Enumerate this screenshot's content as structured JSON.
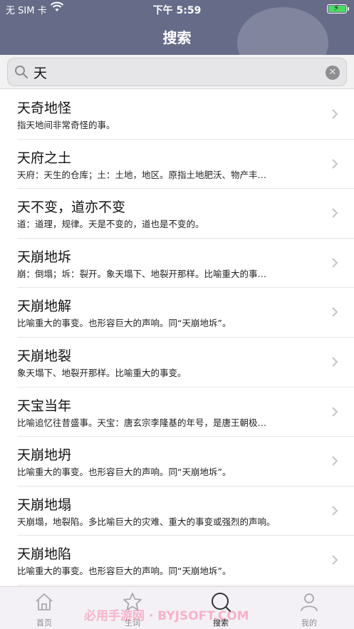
{
  "status": {
    "carrier": "无 SIM 卡",
    "time": "下午 5:59"
  },
  "header": {
    "title": "搜索"
  },
  "search": {
    "value": "天"
  },
  "results": [
    {
      "word": "天奇地怪",
      "desc": "指天地间非常奇怪的事。"
    },
    {
      "word": "天府之土",
      "desc": "天府：天生的仓库；土：土地，地区。原指土地肥沃、物产丰…"
    },
    {
      "word": "天不变，道亦不变",
      "desc": "道：道理，规律。天是不变的，道也是不变的。"
    },
    {
      "word": "天崩地坼",
      "desc": "崩：倒塌；坼：裂开。象天塌下、地裂开那样。比喻重大的事…"
    },
    {
      "word": "天崩地解",
      "desc": "比喻重大的事变。也形容巨大的声响。同“天崩地坼”。"
    },
    {
      "word": "天崩地裂",
      "desc": "象天塌下、地裂开那样。比喻重大的事变。"
    },
    {
      "word": "天宝当年",
      "desc": "比喻追忆往昔盛事。天宝：唐玄宗李隆基的年号，是唐王朝极…"
    },
    {
      "word": "天崩地坍",
      "desc": "比喻重大的事变。也形容巨大的声响。同“天崩地坼”。"
    },
    {
      "word": "天崩地塌",
      "desc": "天崩塌，地裂陷。多比喻巨大的灾难、重大的事变或强烈的声响。"
    },
    {
      "word": "天崩地陷",
      "desc": "比喻重大的事变。也形容巨大的声响。同“天崩地坼”。"
    }
  ],
  "tabs": [
    {
      "label": "首页",
      "icon": "home-icon"
    },
    {
      "label": "生词",
      "icon": "star-icon"
    },
    {
      "label": "搜索",
      "icon": "search-icon"
    },
    {
      "label": "我的",
      "icon": "person-icon"
    }
  ],
  "watermark": "必用手游网 · BYJSOFT.COM",
  "colors": {
    "header": "#666b88",
    "battery": "#4cd964"
  }
}
